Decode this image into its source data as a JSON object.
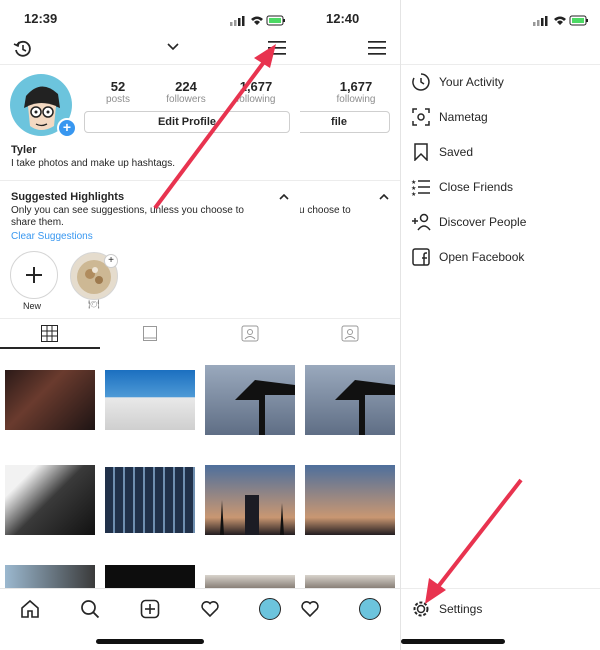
{
  "left": {
    "time": "12:39",
    "stats": [
      {
        "value": "52",
        "label": "posts"
      },
      {
        "value": "224",
        "label": "followers"
      },
      {
        "value": "1,677",
        "label": "following"
      }
    ],
    "edit_profile": "Edit Profile",
    "name": "Tyler",
    "bio": "I take photos and make up hashtags.",
    "suggested_title": "Suggested Highlights",
    "suggested_desc": "Only you can see suggestions, unless you choose to share them.",
    "clear_link": "Clear Suggestions",
    "highlight_new": "New",
    "highlight_food_label": "🍽"
  },
  "middle": {
    "time": "12:40",
    "following_value": "1,677",
    "following_label": "following",
    "edit_fragment": "file",
    "desc_fragment": "u choose to"
  },
  "menu": {
    "items": [
      {
        "label": "Your Activity",
        "icon": "activity-icon"
      },
      {
        "label": "Nametag",
        "icon": "nametag-icon"
      },
      {
        "label": "Saved",
        "icon": "bookmark-icon"
      },
      {
        "label": "Close Friends",
        "icon": "close-friends-icon"
      },
      {
        "label": "Discover People",
        "icon": "add-person-icon"
      },
      {
        "label": "Open Facebook",
        "icon": "facebook-icon"
      }
    ],
    "settings": "Settings"
  },
  "colors": {
    "accent": "#3897f0",
    "arrow": "#e8334f",
    "battery": "#4cd964"
  }
}
